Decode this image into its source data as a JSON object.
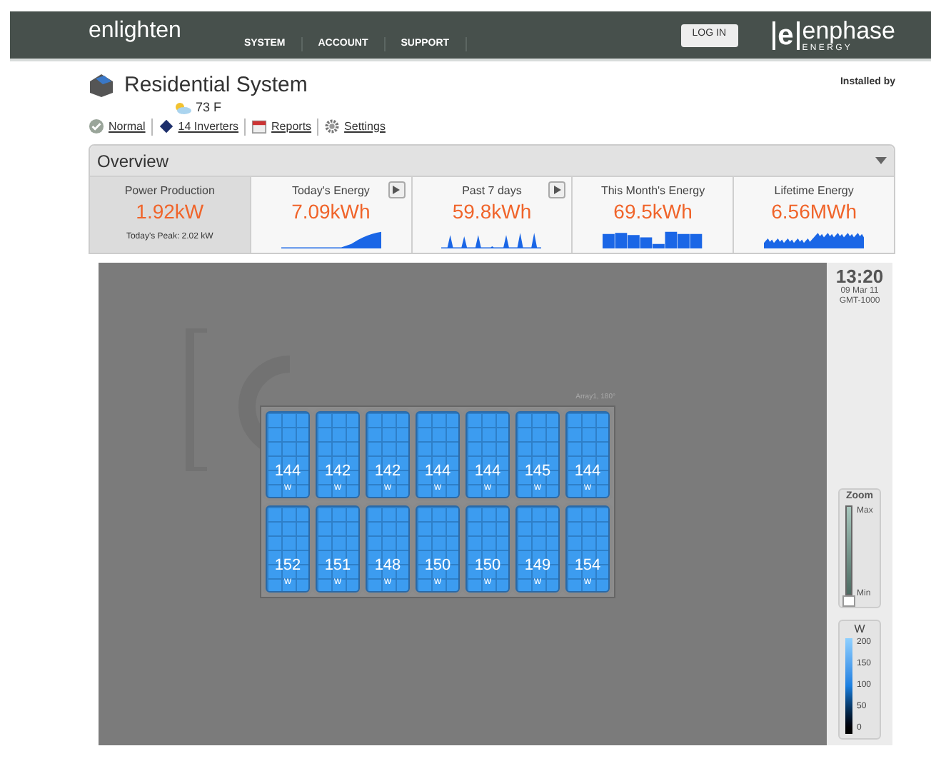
{
  "header": {
    "brand": "enlighten",
    "nav": [
      {
        "label": "SYSTEM"
      },
      {
        "label": "ACCOUNT"
      },
      {
        "label": "SUPPORT"
      }
    ],
    "login": "LOG IN",
    "logo": {
      "letter": "e",
      "name": "enphase",
      "tagline": "E N E R G Y"
    }
  },
  "system": {
    "title": "Residential System",
    "installed_by": "Installed by",
    "weather": "73 F",
    "links": [
      {
        "kind": "status",
        "label": "Normal"
      },
      {
        "kind": "inverter",
        "label": "14 Inverters"
      },
      {
        "kind": "calendar",
        "label": "Reports"
      },
      {
        "kind": "gear",
        "label": "Settings"
      }
    ]
  },
  "overview": {
    "title": "Overview",
    "tiles": [
      {
        "label": "Power Production",
        "value": "1.92kW",
        "note": "Today's Peak: 2.02 kW",
        "selected": true,
        "play_button": false
      },
      {
        "label": "Today's Energy",
        "value": "7.09kWh",
        "selected": false,
        "play_button": true,
        "kind": "ramp"
      },
      {
        "label": "Past 7 days",
        "value": "59.8kWh",
        "selected": false,
        "play_button": true,
        "kind": "peaks"
      },
      {
        "label": "This Month's Energy",
        "value": "69.5kWh",
        "selected": false,
        "play_button": false,
        "kind": "bars"
      },
      {
        "label": "Lifetime Energy",
        "value": "6.56MWh",
        "selected": false,
        "play_button": false,
        "kind": "noise"
      }
    ]
  },
  "array": {
    "label": "Array1, 180°",
    "rows": [
      [
        {
          "watts": "144",
          "unit": "w"
        },
        {
          "watts": "142",
          "unit": "w"
        },
        {
          "watts": "142",
          "unit": "w"
        },
        {
          "watts": "144",
          "unit": "w"
        },
        {
          "watts": "144",
          "unit": "w"
        },
        {
          "watts": "145",
          "unit": "w"
        },
        {
          "watts": "144",
          "unit": "w"
        }
      ],
      [
        {
          "watts": "152",
          "unit": "w"
        },
        {
          "watts": "151",
          "unit": "w"
        },
        {
          "watts": "148",
          "unit": "w"
        },
        {
          "watts": "150",
          "unit": "w"
        },
        {
          "watts": "150",
          "unit": "w"
        },
        {
          "watts": "149",
          "unit": "w"
        },
        {
          "watts": "154",
          "unit": "w"
        }
      ]
    ]
  },
  "clock": {
    "time": "13:20",
    "date": "09 Mar 11",
    "zone": "GMT-1000"
  },
  "zoom": {
    "title": "Zoom",
    "max": "Max",
    "min": "Min",
    "level": 0
  },
  "legend": {
    "title": "W",
    "ticks": [
      "200",
      "150",
      "100",
      "50",
      "0"
    ]
  }
}
